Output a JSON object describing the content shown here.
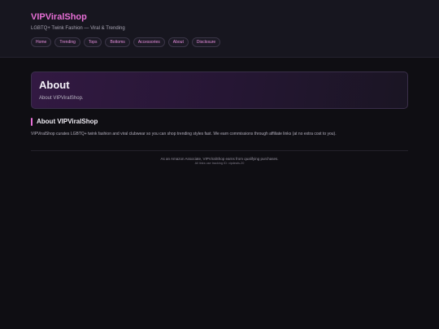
{
  "header": {
    "brand": "VIPViralShop",
    "tagline": "LGBTQ+ Twink Fashion — Viral & Trending",
    "nav": [
      "Home",
      "Trending",
      "Tops",
      "Bottoms",
      "Accessories",
      "About",
      "Disclosure"
    ]
  },
  "hero": {
    "title": "About",
    "subtitle": "About VIPViralShop."
  },
  "section": {
    "title": "About VIPViralShop",
    "body": "VIPViralShop curates LGBTQ+ twink fashion and viral clubwear so you can shop trending styles fast. We earn commissions through affiliate links (at no extra cost to you)."
  },
  "footer": {
    "line1": "As an Amazon Associate, VIPViralShop earns from qualifying purchases.",
    "line2": "All links use tracking ID: vipdeals-20"
  },
  "colors": {
    "accent": "#e76fd6",
    "background": "#0f0e13"
  }
}
